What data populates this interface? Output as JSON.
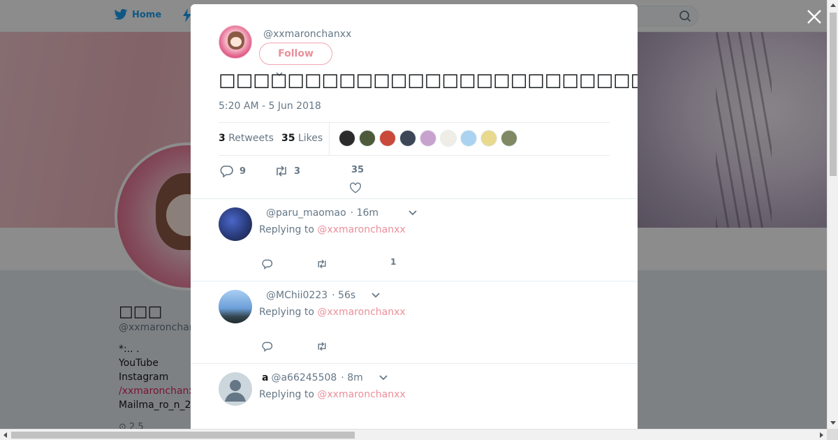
{
  "nav": {
    "home_label": "Home"
  },
  "profile": {
    "name": "□□□",
    "handle": "@xxmaronchanxx",
    "bio": [
      "*:.. .",
      "YouTube",
      "Instagram",
      "/xxmaronchanx",
      "Mailma_ro_n_2"
    ],
    "meta": "⊙ 2.5"
  },
  "tweet": {
    "author_handle": "@xxmaronchanxx",
    "follow_label": "Follow",
    "text": "□□□□□□□□□□□□□□□□□□□□□□□□□□□□□□□□□□□□□□□□□□□□□□□□□□",
    "timestamp": "5:20 AM - 5 Jun 2018",
    "retweets_count": "3",
    "retweets_label": "Retweets",
    "likes_count": "35",
    "likes_label": "Likes",
    "reply_count": "9",
    "retweet_action_count": "3",
    "like_action_count": "35",
    "liker_colors": [
      "#2b2b2b",
      "#4d5a3c",
      "#c9493a",
      "#3c4656",
      "#c8a2cf",
      "#f0ede6",
      "#a9d3f0",
      "#e8d98f",
      "#7f8a64"
    ]
  },
  "replies": [
    {
      "name": "",
      "handle": "@paru_maomao",
      "time": "· 16m",
      "replying_prefix": "Replying to",
      "mention": "@xxmaronchanxx",
      "like_count": "1",
      "avatar_color": "#2a3b7a"
    },
    {
      "name": "",
      "handle": "@MChii0223",
      "time": "· 56s",
      "replying_prefix": "Replying to",
      "mention": "@xxmaronchanxx",
      "like_count": "",
      "avatar_color": "#6c9fd8"
    },
    {
      "name": "a",
      "handle": "@a66245508",
      "time": "· 8m",
      "replying_prefix": "Replying to",
      "mention": "@xxmaronchanxx",
      "like_count": "",
      "avatar_color": "#ccd6dd"
    }
  ]
}
